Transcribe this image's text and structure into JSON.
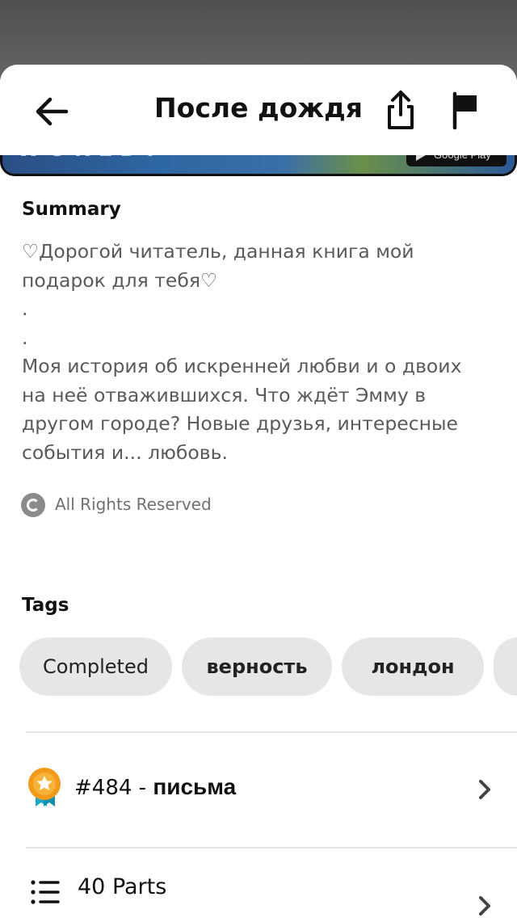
{
  "header": {
    "title": "После дождя"
  },
  "banner": {
    "text": "WORLD!",
    "store_badge": "Google Play"
  },
  "summary": {
    "heading": "Summary",
    "text": "♡Дорогой читатель, данная книга мой\nподарок для тебя♡\n.\n.\nМоя история об искренней любви и о двоих\nна неё отважившихся. Что ждёт Эмму в\nдругом городе? Новые друзья, интересные\nсобытия и... любовь."
  },
  "rights": {
    "label": "All Rights Reserved"
  },
  "tags": {
    "heading": "Tags",
    "items": [
      "Completed",
      "верность",
      "лондон"
    ]
  },
  "ranking": {
    "number": "#484 - ",
    "name": "письма"
  },
  "parts": {
    "label": "40 Parts"
  },
  "colors": {
    "ranking_medal": "#f39a1a",
    "ribbon": "#1aa6c8"
  }
}
